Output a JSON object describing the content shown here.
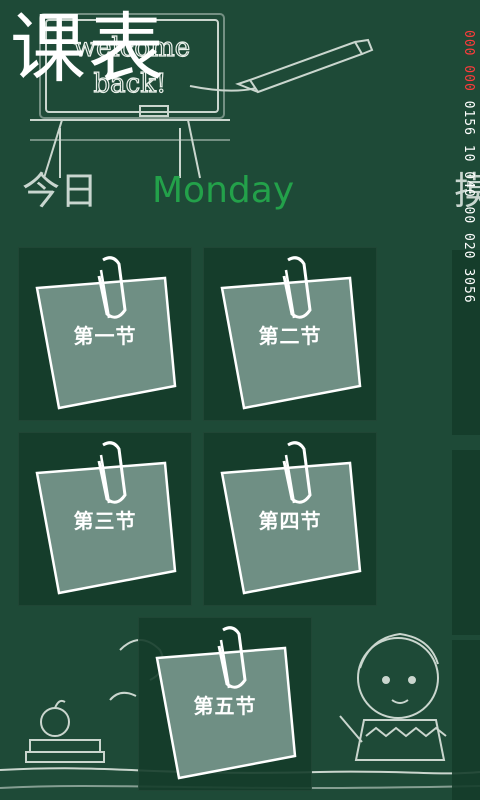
{
  "app": {
    "title": "课表"
  },
  "board": {
    "text_line1": "welcome",
    "text_line2": "back!"
  },
  "pivot": {
    "items": [
      "今日",
      "Monday",
      "摸"
    ]
  },
  "tiles": [
    {
      "label": "第一节"
    },
    {
      "label": "第二节"
    },
    {
      "label": "第三节"
    },
    {
      "label": "第四节"
    },
    {
      "label": "第五节"
    }
  ],
  "status": {
    "signal": "000 000",
    "text": "0156 10 040 00 020 3056"
  },
  "colors": {
    "background": "#1e4a37",
    "accent": "#23a14a",
    "note": "#6f8f84"
  }
}
